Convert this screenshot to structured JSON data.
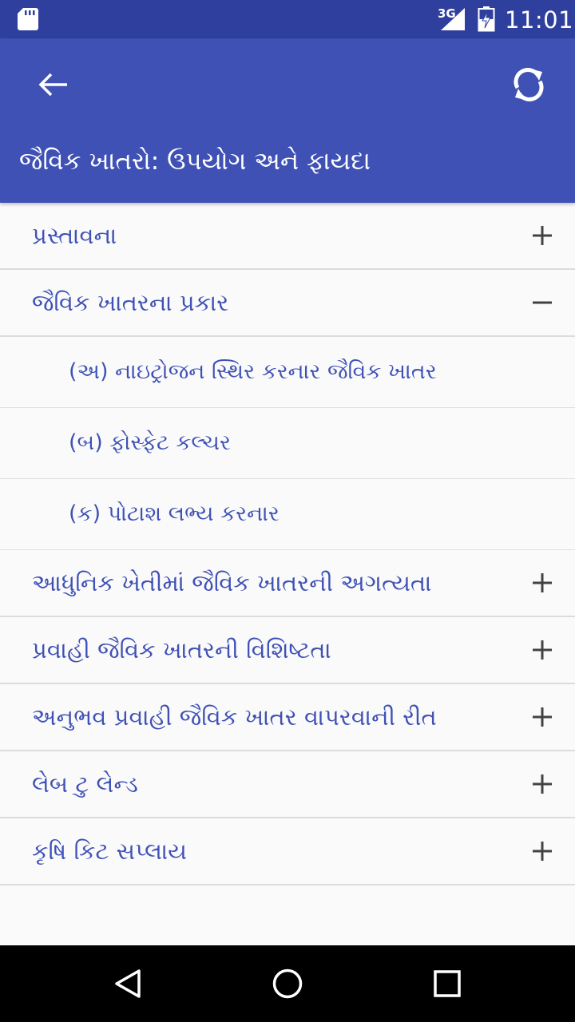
{
  "status_bar": {
    "network": "3G",
    "time": "11:01"
  },
  "app_bar": {
    "title": "જૈવિક ખાતરો: ઉપયોગ અને ફાયદા"
  },
  "menu": [
    {
      "label": "પ્રસ્તાવના",
      "type": "group",
      "state": "collapsed"
    },
    {
      "label": "જૈવિક ખાતરના પ્રકાર",
      "type": "group",
      "state": "expanded"
    },
    {
      "label": "(અ)  નાઇટ્રોજન સ્થિર કરનાર જૈવિક ખાતર",
      "type": "child"
    },
    {
      "label": "(બ)  ફોસ્ફેટ કલ્ચર",
      "type": "child"
    },
    {
      "label": "(ક) પોટાશ લભ્ય કરનાર",
      "type": "child"
    },
    {
      "label": "આધુનિક ખેતીમાં જૈવિક ખાતરની અગત્યતા",
      "type": "group",
      "state": "collapsed"
    },
    {
      "label": "પ્રવાહી જૈવિક ખાતરની વિશિષ્ટતા",
      "type": "group",
      "state": "collapsed"
    },
    {
      "label": "અનુભવ પ્રવાહી જૈવિક ખાતર વાપરવાની રીત",
      "type": "group",
      "state": "collapsed"
    },
    {
      "label": "લેબ ટુ લેન્ડ",
      "type": "group",
      "state": "collapsed"
    },
    {
      "label": "કૃષિ કિટ સપ્લાય",
      "type": "group",
      "state": "collapsed"
    }
  ],
  "icons": {
    "back": "arrow-back-icon",
    "refresh": "refresh-icon",
    "expand": "plus-icon",
    "collapse": "minus-icon",
    "nav_back": "triangle-back-icon",
    "nav_home": "circle-home-icon",
    "nav_recents": "square-recents-icon"
  },
  "colors": {
    "status_bar": "#2f3f9e",
    "app_bar": "#3f51b5",
    "list_text": "#3f51b5",
    "toggle_icon": "#424242"
  }
}
